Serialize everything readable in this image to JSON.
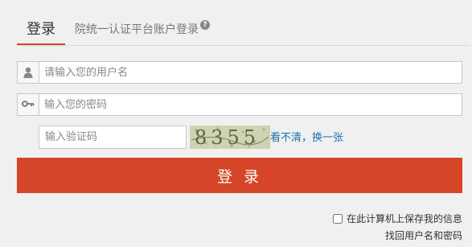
{
  "tabs": {
    "active_label": "登录",
    "description": "院统一认证平台账户登录",
    "help_glyph": "?"
  },
  "form": {
    "username_placeholder": "请输入您的用户名",
    "password_placeholder": "输入您的密码",
    "captcha_placeholder": "输入验证码",
    "captcha_text": "8355",
    "refresh_link": "看不清，换一张",
    "login_button": "登 录",
    "remember_label": "在此计算机上保存我的信息",
    "recover_link": "找回用户名和密码"
  },
  "icons": {
    "username": "user-icon",
    "password": "key-icon",
    "help": "question-icon"
  },
  "colors": {
    "accent": "#d44627",
    "link": "#1a6fb3"
  }
}
